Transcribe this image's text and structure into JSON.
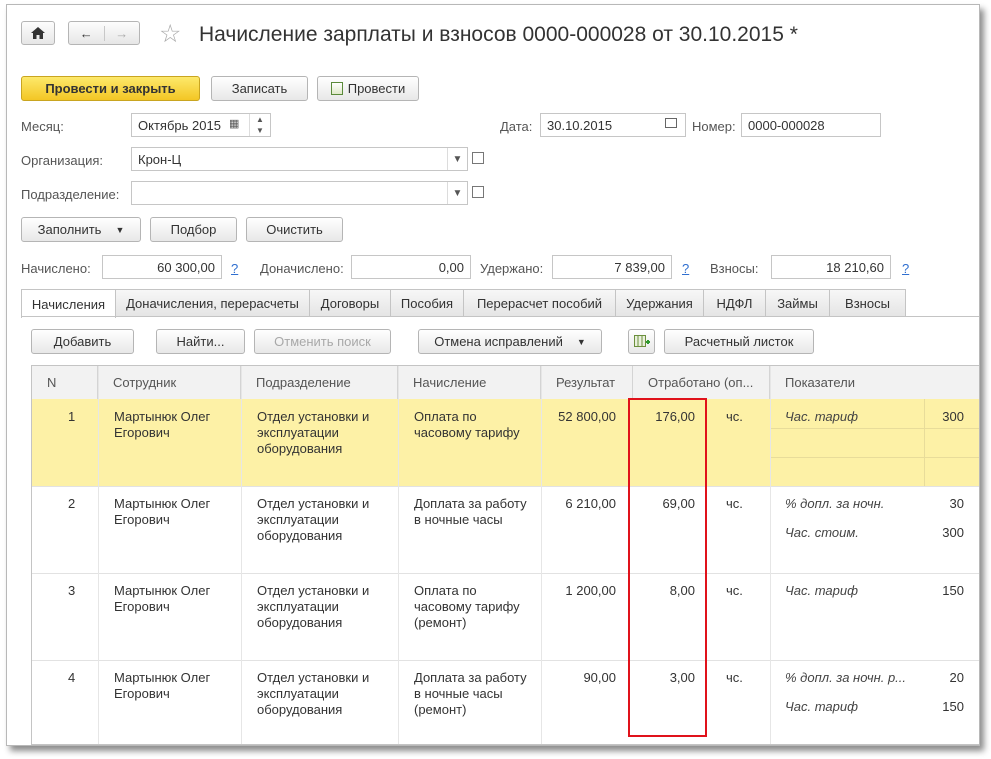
{
  "header": {
    "title": "Начисление зарплаты и взносов 0000-000028 от 30.10.2015 *"
  },
  "toolbar": {
    "post_close": "Провести и закрыть",
    "save": "Записать",
    "post": "Провести"
  },
  "form": {
    "month_label": "Месяц:",
    "month_value": "Октябрь 2015",
    "date_label": "Дата:",
    "date_value": "30.10.2015",
    "number_label": "Номер:",
    "number_value": "0000-000028",
    "org_label": "Организация:",
    "org_value": "Крон-Ц",
    "division_label": "Подразделение:",
    "division_value": ""
  },
  "actions": {
    "fill": "Заполнить",
    "select": "Подбор",
    "clear": "Очистить"
  },
  "totals": {
    "accrued_label": "Начислено:",
    "accrued": "60 300,00",
    "additional_label": "Доначислено:",
    "additional": "0,00",
    "withheld_label": "Удержано:",
    "withheld": "7 839,00",
    "contrib_label": "Взносы:",
    "contrib": "18 210,60",
    "help": "?"
  },
  "tabs": [
    "Начисления",
    "Доначисления, перерасчеты",
    "Договоры",
    "Пособия",
    "Перерасчет пособий",
    "Удержания",
    "НДФЛ",
    "Займы",
    "Взносы"
  ],
  "grid_toolbar": {
    "add": "Добавить",
    "find": "Найти...",
    "cancel_search": "Отменить поиск",
    "cancel_corrections": "Отмена исправлений",
    "payslip": "Расчетный листок"
  },
  "table": {
    "columns": [
      "N",
      "Сотрудник",
      "Подразделение",
      "Начисление",
      "Результат",
      "Отработано (оп...",
      "Показатели"
    ],
    "rows": [
      {
        "n": "1",
        "employee": "Мартынюк Олег Егорович",
        "division": "Отдел установки и эксплуатации оборудования",
        "accrual": "Оплата по часовому тарифу",
        "result": "52 800,00",
        "worked": "176,00",
        "unit": "чс.",
        "ind1": "Час. тариф",
        "val1": "300"
      },
      {
        "n": "2",
        "employee": "Мартынюк Олег Егорович",
        "division": "Отдел установки и эксплуатации оборудования",
        "accrual": "Доплата за работу в ночные часы",
        "result": "6 210,00",
        "worked": "69,00",
        "unit": "чс.",
        "ind1": "% допл. за ночн.",
        "val1": "30",
        "ind2": "Час. стоим.",
        "val2": "300"
      },
      {
        "n": "3",
        "employee": "Мартынюк Олег Егорович",
        "division": "Отдел установки и эксплуатации оборудования",
        "accrual": "Оплата по часовому тарифу (ремонт)",
        "result": "1 200,00",
        "worked": "8,00",
        "unit": "чс.",
        "ind1": "Час. тариф",
        "val1": "150"
      },
      {
        "n": "4",
        "employee": "Мартынюк Олег Егорович",
        "division": "Отдел установки и эксплуатации оборудования",
        "accrual": "Доплата за работу в ночные часы (ремонт)",
        "result": "90,00",
        "worked": "3,00",
        "unit": "чс.",
        "ind1": "% допл. за ночн. р...",
        "val1": "20",
        "ind2": "Час. тариф",
        "val2": "150"
      }
    ]
  },
  "colors": {
    "primary_button": "#f3c624",
    "selected_row": "#fdf1a6",
    "highlight_border": "#e0121b",
    "help_link": "#2f6fd0"
  }
}
